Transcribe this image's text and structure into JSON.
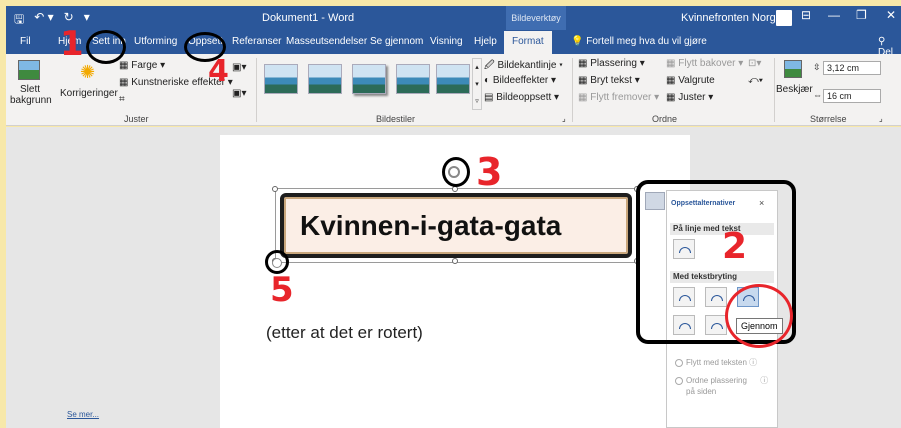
{
  "titlebar": {
    "quick_access": [
      "🖫",
      "↶ ▾",
      "↻",
      "▾"
    ],
    "doc_title": "Dokument1 - Word",
    "context_tab_group": "Bildeverktøy",
    "user_name": "Kvinnefronten Norge",
    "window_controls": [
      "⊟",
      "—",
      "❐",
      "✕"
    ]
  },
  "tabs": {
    "items": [
      "Fil",
      "Hjem",
      "Sett inn",
      "Utforming",
      "Oppsett",
      "Referanser",
      "Masseutsendelser",
      "Se gjennom",
      "Visning",
      "Hjelp"
    ],
    "active": "Format",
    "tell_me": "Fortell meg hva du vil gjøre",
    "share": "Del"
  },
  "ribbon": {
    "adjust": {
      "remove_bg": "Slett bakgrunn",
      "corrections": "Korrigeringer",
      "color": "Farge ▾",
      "artistic": "Kunstneriske effekter ▾",
      "label": "Juster"
    },
    "styles": {
      "label": "Bildestiler",
      "border": "Bildekantlinje ▾",
      "effects": "Bildeeffekter ▾",
      "layout": "Bildeoppsett ▾"
    },
    "arrange": {
      "position": "Plassering ▾",
      "wrap": "Bryt tekst ▾",
      "forward": "Flytt fremover ▾",
      "backward": "Flytt bakover ▾",
      "select": "Valgrute",
      "align": "Juster ▾",
      "label": "Ordne"
    },
    "size": {
      "crop": "Beskjær",
      "height": "3,12 cm",
      "width": "16 cm",
      "label": "Størrelse"
    }
  },
  "document": {
    "shape_text": "Kvinnen-i-gata-gata",
    "note": "(etter at det er rotert)"
  },
  "layout_pane": {
    "title": "Oppsettalternativer",
    "close": "×",
    "inline_header": "På linje med tekst",
    "wrap_header": "Med tekstbryting",
    "tooltip": "Gjennom",
    "move_with_text": "Flytt med teksten",
    "fix_position": "Ordne plassering på siden",
    "see_more": "Se mer..."
  },
  "annotations": {
    "numbers": [
      "1",
      "2",
      "3",
      "4",
      "5"
    ],
    "color": "#e8252b"
  }
}
